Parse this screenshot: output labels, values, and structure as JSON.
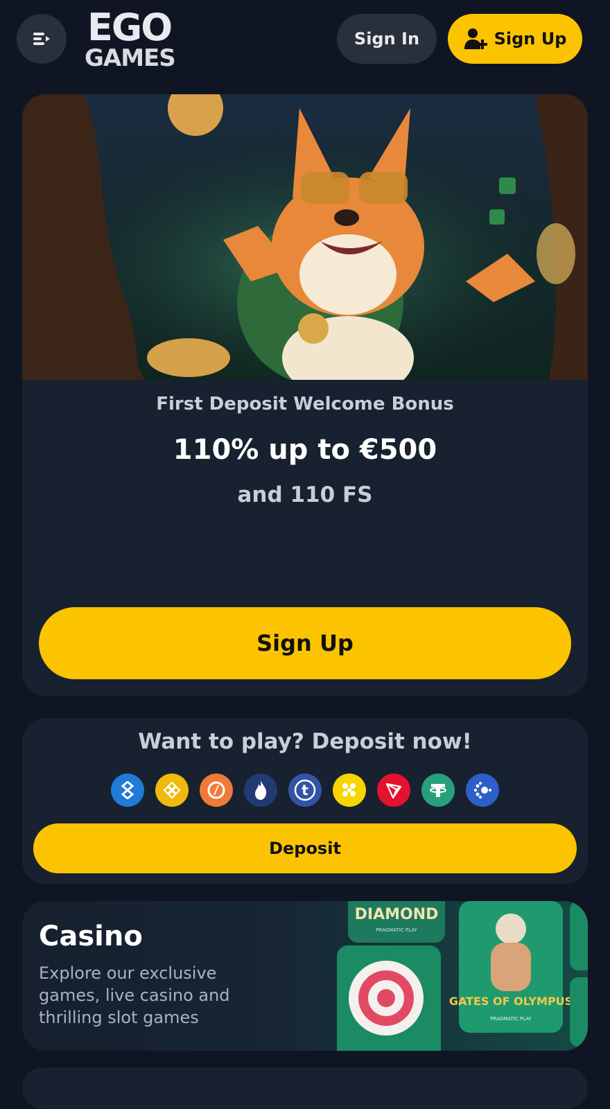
{
  "header": {
    "logo_line1": "EGO",
    "logo_line2": "GAMES",
    "sign_in_label": "Sign In",
    "sign_up_label": "Sign Up"
  },
  "promo": {
    "subtitle": "First Deposit Welcome Bonus",
    "amount": "110% up to €500",
    "free_spins": "and 110 FS",
    "button_label": "Sign Up"
  },
  "deposit": {
    "title": "Want to play? Deposit now!",
    "button_label": "Deposit",
    "currencies": [
      {
        "icon": "bitcoin-cash-icon",
        "color": "#1f7bd6"
      },
      {
        "icon": "binance-coin-icon",
        "color": "#f0b90b"
      },
      {
        "icon": "rollbit-icon",
        "color": "#ef7a3a"
      },
      {
        "icon": "flame-token-icon",
        "color": "#223a74"
      },
      {
        "icon": "tron-t-icon",
        "color": "#3553a6"
      },
      {
        "icon": "dogecoin-dots-icon",
        "color": "#f6d500"
      },
      {
        "icon": "tron-icon",
        "color": "#e5112f"
      },
      {
        "icon": "tether-icon",
        "color": "#26a17b"
      },
      {
        "icon": "cardano-icon",
        "color": "#2c5fc8"
      }
    ]
  },
  "casino": {
    "title": "Casino",
    "description": "Explore our exclusive games, live casino and thrilling slot games",
    "game_tile_1": "DIAMOND",
    "game_tile_2": "GATES OF OLYMPUS",
    "provider": "PRAGMATIC PLAY"
  },
  "colors": {
    "background": "#0f1522",
    "card": "#18212f",
    "accent": "#fcc400",
    "secondary_button": "#2a303b"
  }
}
